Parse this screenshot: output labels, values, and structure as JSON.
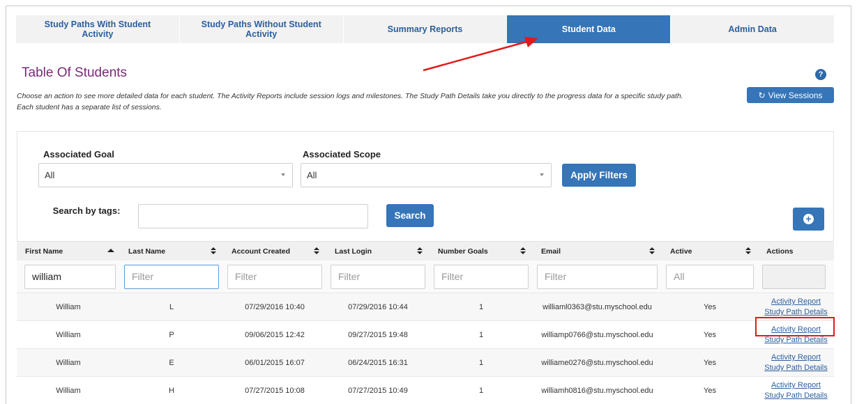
{
  "tabs": [
    {
      "label": "Study Paths With Student Activity",
      "active": false
    },
    {
      "label": "Study Paths Without Student Activity",
      "active": false
    },
    {
      "label": "Summary Reports",
      "active": false
    },
    {
      "label": "Student Data",
      "active": true
    },
    {
      "label": "Admin Data",
      "active": false
    }
  ],
  "page": {
    "title": "Table Of Students",
    "help_icon": "?",
    "description_line1": "Choose an action to see more detailed data for each student. The Activity Reports include session logs and milestones. The Study Path Details take you directly to the progress data for a specific study path.",
    "description_line2": "Each student has a separate list of sessions.",
    "view_sessions_label": "View Sessions",
    "view_sessions_icon": "refresh-icon"
  },
  "filters": {
    "goal_label": "Associated Goal",
    "goal_value": "All",
    "scope_label": "Associated Scope",
    "scope_value": "All",
    "apply_label": "Apply Filters",
    "tags_label": "Search by tags:",
    "tags_value": "",
    "search_label": "Search",
    "add_icon": "plus-circle-icon"
  },
  "table": {
    "columns": [
      "First Name",
      "Last Name",
      "Account Created",
      "Last Login",
      "Number Goals",
      "Email",
      "Active",
      "Actions"
    ],
    "filter_values": [
      "william",
      "Filter",
      "Filter",
      "Filter",
      "Filter",
      "Filter",
      "All",
      ""
    ],
    "rows": [
      {
        "first": "William",
        "last": "L",
        "created": "07/29/2016 10:40",
        "login": "07/29/2016 10:44",
        "goals": "1",
        "email": "williaml0363@stu.myschool.edu",
        "active": "Yes",
        "action1": "Activity Report",
        "action2": "Study Path Details"
      },
      {
        "first": "William",
        "last": "P",
        "created": "09/06/2015 12:42",
        "login": "09/27/2015 19:48",
        "goals": "1",
        "email": "williamp0766@stu.myschool.edu",
        "active": "Yes",
        "action1": "Activity Report",
        "action2": "Study Path Details"
      },
      {
        "first": "William",
        "last": "E",
        "created": "06/01/2015 16:07",
        "login": "06/24/2015 16:31",
        "goals": "1",
        "email": "williame0276@stu.myschool.edu",
        "active": "Yes",
        "action1": "Activity Report",
        "action2": "Study Path Details"
      },
      {
        "first": "William",
        "last": "H",
        "created": "07/27/2015 10:08",
        "login": "07/27/2015 10:49",
        "goals": "1",
        "email": "williamh0816@stu.myschool.edu",
        "active": "Yes",
        "action1": "Activity Report",
        "action2": "Study Path Details"
      }
    ]
  },
  "colors": {
    "accent": "#3575b8",
    "title": "#7a2a78",
    "annotation": "#e01b1b"
  }
}
